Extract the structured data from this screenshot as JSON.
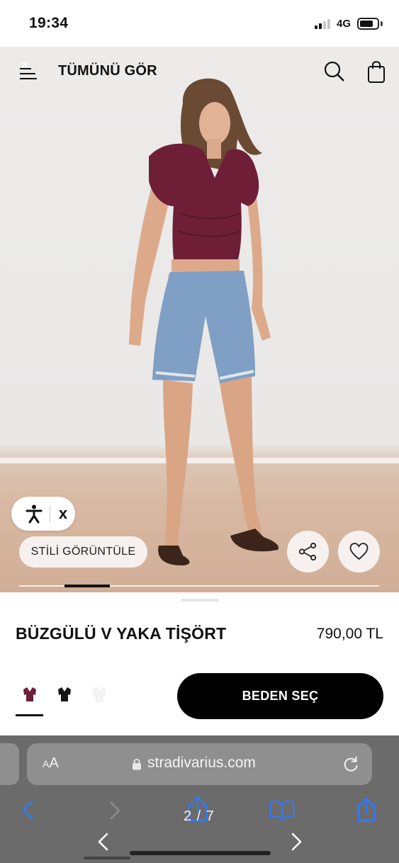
{
  "status_bar": {
    "time": "19:34",
    "network": "4G"
  },
  "header": {
    "title": "TÜMÜNÜ GÖR"
  },
  "hero": {
    "accessibility_close": "x",
    "style_button": "STİLİ GÖRÜNTÜLE",
    "carousel_position": {
      "current": 2,
      "total": 7
    }
  },
  "product": {
    "name": "BÜZGÜLÜ V YAKA TİŞÖRT",
    "price": "790,00 TL",
    "swatches": [
      {
        "name": "bordo",
        "color": "#6e1f37",
        "selected": true
      },
      {
        "name": "siyah",
        "color": "#161616",
        "selected": false
      },
      {
        "name": "beyaz",
        "color": "#f3f3f3",
        "selected": false
      }
    ],
    "size_button": "BEDEN SEÇ"
  },
  "browser": {
    "text_size_label": "AA",
    "url": "stradivarius.com",
    "page_counter": "2 / 7"
  },
  "colors": {
    "primary_button": "#000000",
    "pill_background": "#f6f1ee",
    "safari_toolbar": "#6b6b6b",
    "safari_field": "#8f8f8f",
    "ios_blue": "#3478f6"
  }
}
